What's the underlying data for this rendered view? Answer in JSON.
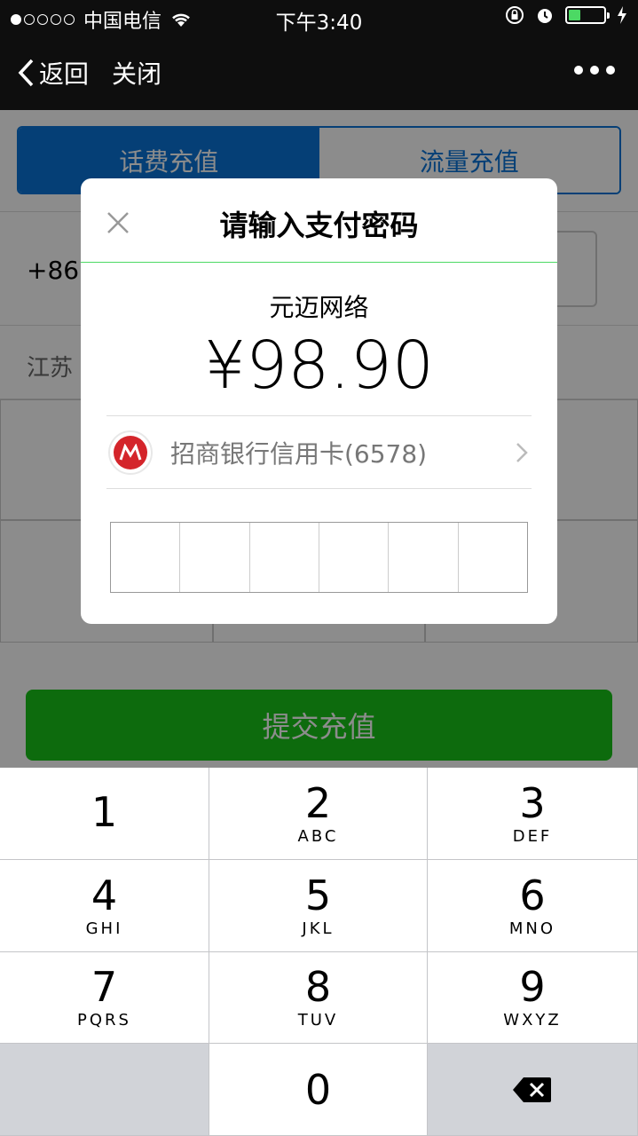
{
  "status_bar": {
    "carrier": "中国电信",
    "time": "下午3:40",
    "battery_level": 0.35
  },
  "nav": {
    "back_label": "返回",
    "close_label": "关闭"
  },
  "page": {
    "tabs": [
      {
        "label": "话费充值",
        "active": true
      },
      {
        "label": "流量充值",
        "active": false
      }
    ],
    "phone_prefix": "+86",
    "region": "江苏",
    "submit_label": "提交充值",
    "colors": {
      "accent": "#0a74d8",
      "submit": "#18c418"
    }
  },
  "dialog": {
    "title": "请输入支付密码",
    "merchant": "元迈网络",
    "amount": "¥98.90",
    "card_label": "招商银行信用卡(6578)",
    "password_length": 6
  },
  "keypad": {
    "keys": [
      {
        "num": "1",
        "letters": ""
      },
      {
        "num": "2",
        "letters": "ABC"
      },
      {
        "num": "3",
        "letters": "DEF"
      },
      {
        "num": "4",
        "letters": "GHI"
      },
      {
        "num": "5",
        "letters": "JKL"
      },
      {
        "num": "6",
        "letters": "MNO"
      },
      {
        "num": "7",
        "letters": "PQRS"
      },
      {
        "num": "8",
        "letters": "TUV"
      },
      {
        "num": "9",
        "letters": "WXYZ"
      },
      {
        "num": "0",
        "letters": ""
      }
    ]
  }
}
